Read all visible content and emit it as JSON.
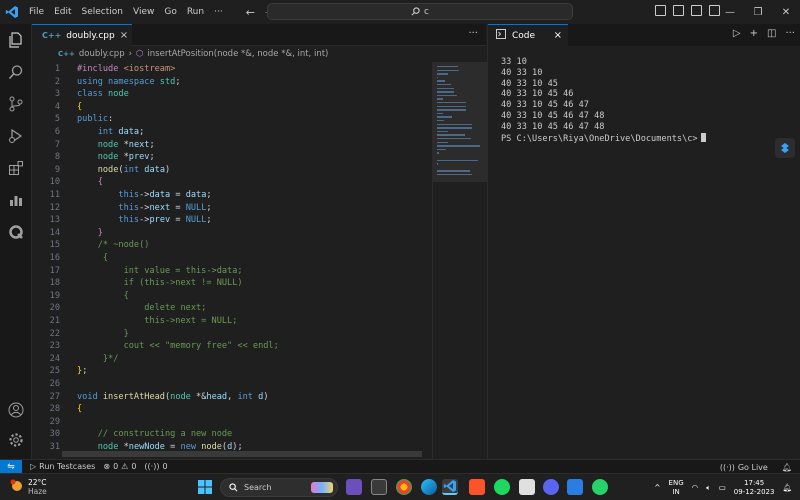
{
  "menu": [
    "File",
    "Edit",
    "Selection",
    "View",
    "Go",
    "Run",
    "···"
  ],
  "search_text": "c",
  "editor": {
    "tab_icon": "C++",
    "tab_label": "doubly.cpp",
    "more": "···",
    "breadcrumb_file": "doubly.cpp",
    "breadcrumb_sep": "›",
    "breadcrumb_symbol": "insertAtPosition(node *&, node *&, int, int)"
  },
  "code_lines": [
    {
      "n": "1",
      "t": [
        [
          "inc",
          "#include "
        ],
        [
          "str",
          "<iostream>"
        ]
      ]
    },
    {
      "n": "2",
      "t": [
        [
          "kw",
          "using "
        ],
        [
          "kw",
          "namespace "
        ],
        [
          "typ",
          "std"
        ],
        [
          "plain",
          ";"
        ]
      ]
    },
    {
      "n": "3",
      "t": [
        [
          "kw",
          "class "
        ],
        [
          "typ",
          "node"
        ]
      ]
    },
    {
      "n": "4",
      "t": [
        [
          "br",
          "{"
        ]
      ]
    },
    {
      "n": "5",
      "t": [
        [
          "kw",
          "public"
        ],
        [
          "plain",
          ":"
        ]
      ]
    },
    {
      "n": "6",
      "t": [
        [
          "plain",
          "    "
        ],
        [
          "kw",
          "int "
        ],
        [
          "var",
          "data"
        ],
        [
          "plain",
          ";"
        ]
      ]
    },
    {
      "n": "7",
      "t": [
        [
          "plain",
          "    "
        ],
        [
          "typ",
          "node "
        ],
        [
          "plain",
          "*"
        ],
        [
          "var",
          "next"
        ],
        [
          "plain",
          ";"
        ]
      ]
    },
    {
      "n": "8",
      "t": [
        [
          "plain",
          "    "
        ],
        [
          "typ",
          "node "
        ],
        [
          "plain",
          "*"
        ],
        [
          "var",
          "prev"
        ],
        [
          "plain",
          ";"
        ]
      ]
    },
    {
      "n": "9",
      "t": [
        [
          "plain",
          "    "
        ],
        [
          "fn",
          "node"
        ],
        [
          "plain",
          "("
        ],
        [
          "kw",
          "int "
        ],
        [
          "var",
          "data"
        ],
        [
          "plain",
          ")"
        ]
      ]
    },
    {
      "n": "10",
      "t": [
        [
          "plain",
          "    "
        ],
        [
          "ctl",
          "{"
        ]
      ]
    },
    {
      "n": "11",
      "t": [
        [
          "plain",
          "        "
        ],
        [
          "kw",
          "this"
        ],
        [
          "plain",
          "->"
        ],
        [
          "var",
          "data"
        ],
        [
          "plain",
          " = "
        ],
        [
          "var",
          "data"
        ],
        [
          "plain",
          ";"
        ]
      ]
    },
    {
      "n": "12",
      "t": [
        [
          "plain",
          "        "
        ],
        [
          "kw",
          "this"
        ],
        [
          "plain",
          "->"
        ],
        [
          "var",
          "next"
        ],
        [
          "plain",
          " = "
        ],
        [
          "mac",
          "NULL"
        ],
        [
          "plain",
          ";"
        ]
      ]
    },
    {
      "n": "13",
      "t": [
        [
          "plain",
          "        "
        ],
        [
          "kw",
          "this"
        ],
        [
          "plain",
          "->"
        ],
        [
          "var",
          "prev"
        ],
        [
          "plain",
          " = "
        ],
        [
          "mac",
          "NULL"
        ],
        [
          "plain",
          ";"
        ]
      ]
    },
    {
      "n": "14",
      "t": [
        [
          "plain",
          "    "
        ],
        [
          "ctl",
          "}"
        ]
      ]
    },
    {
      "n": "15",
      "t": [
        [
          "plain",
          "    "
        ],
        [
          "cm",
          "/* ~node()"
        ]
      ]
    },
    {
      "n": "16",
      "t": [
        [
          "cm",
          "     {"
        ]
      ]
    },
    {
      "n": "17",
      "t": [
        [
          "cm",
          "         int value = this->data;"
        ]
      ]
    },
    {
      "n": "18",
      "t": [
        [
          "cm",
          "         if (this->next != NULL)"
        ]
      ]
    },
    {
      "n": "19",
      "t": [
        [
          "cm",
          "         {"
        ]
      ]
    },
    {
      "n": "20",
      "t": [
        [
          "cm",
          "             delete next;"
        ]
      ]
    },
    {
      "n": "21",
      "t": [
        [
          "cm",
          "             this->next = NULL;"
        ]
      ]
    },
    {
      "n": "22",
      "t": [
        [
          "cm",
          "         }"
        ]
      ]
    },
    {
      "n": "23",
      "t": [
        [
          "cm",
          "         cout << \"memory free\" << endl;"
        ]
      ]
    },
    {
      "n": "24",
      "t": [
        [
          "cm",
          "     }*/"
        ]
      ]
    },
    {
      "n": "25",
      "t": [
        [
          "br",
          "}"
        ],
        [
          "plain",
          ";"
        ]
      ]
    },
    {
      "n": "26",
      "t": []
    },
    {
      "n": "27",
      "t": [
        [
          "kw",
          "void "
        ],
        [
          "fn",
          "insertAtHead"
        ],
        [
          "plain",
          "("
        ],
        [
          "typ",
          "node "
        ],
        [
          "plain",
          "*&"
        ],
        [
          "var",
          "head"
        ],
        [
          "plain",
          ", "
        ],
        [
          "kw",
          "int "
        ],
        [
          "var",
          "d"
        ],
        [
          "plain",
          ")"
        ]
      ]
    },
    {
      "n": "28",
      "t": [
        [
          "br",
          "{"
        ]
      ]
    },
    {
      "n": "29",
      "t": []
    },
    {
      "n": "30",
      "t": [
        [
          "plain",
          "    "
        ],
        [
          "cm",
          "// constructing a new node"
        ]
      ]
    },
    {
      "n": "31",
      "t": [
        [
          "plain",
          "    "
        ],
        [
          "typ",
          "node "
        ],
        [
          "plain",
          "*"
        ],
        [
          "var",
          "newNode"
        ],
        [
          "plain",
          " = "
        ],
        [
          "kw",
          "new "
        ],
        [
          "fn",
          "node"
        ],
        [
          "plain",
          "("
        ],
        [
          "var",
          "d"
        ],
        [
          "plain",
          ");"
        ]
      ]
    }
  ],
  "panel": {
    "tab_label": "Code",
    "terminal_lines": [
      "33 10",
      "40 33 10",
      "40 33 10 45",
      "40 33 10 45 46",
      "40 33 10 45 46 47",
      "40 33 10 45 46 47 48",
      "40 33 10 45 46 47 48"
    ],
    "prompt": "PS C:\\Users\\Riya\\OneDrive\\Documents\\c>"
  },
  "status": {
    "run_testcases": "Run Testcases",
    "errors": "0",
    "warnings": "0",
    "ports": "0",
    "go_live": "Go Live"
  },
  "taskbar": {
    "temperature": "22°C",
    "condition": "Haze",
    "search_placeholder": "Search",
    "lang_line1": "ENG",
    "lang_line2": "IN",
    "time": "17:45",
    "date": "09-12-2023"
  },
  "colors": {
    "accent": "#0078d4",
    "editor_bg": "#1f1f1f",
    "chrome_bg": "#181818"
  }
}
